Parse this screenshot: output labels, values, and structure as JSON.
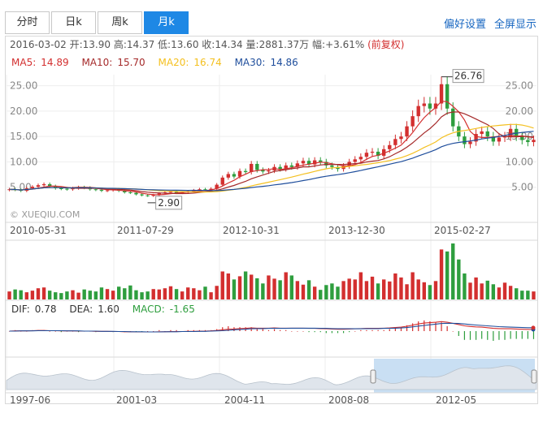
{
  "tabs": [
    {
      "label": "分时",
      "active": false
    },
    {
      "label": "日k",
      "active": false
    },
    {
      "label": "周k",
      "active": false
    },
    {
      "label": "月k",
      "active": true
    }
  ],
  "tools": {
    "prefs": "偏好设置",
    "fullscreen": "全屏显示"
  },
  "info": {
    "date": "2016-03-02",
    "open_label": "开:",
    "open": "13.90",
    "high_label": "高:",
    "high": "14.37",
    "low_label": "低:",
    "low": "13.60",
    "close_label": "收:",
    "close": "14.34",
    "vol_label": "量:",
    "vol": "2881.37万",
    "chg_label": "幅:",
    "chg": "+3.61%",
    "adjust": "(前复权)"
  },
  "ma": [
    {
      "label": "MA5:",
      "value": "14.89",
      "color": "#d32f2f"
    },
    {
      "label": "MA10:",
      "value": "15.70",
      "color": "#a52a2a"
    },
    {
      "label": "MA20:",
      "value": "16.74",
      "color": "#f4c020"
    },
    {
      "label": "MA30:",
      "value": "14.86",
      "color": "#1f4e9c"
    }
  ],
  "macd": [
    {
      "label": "DIF:",
      "value": "0.78",
      "color": "#333333"
    },
    {
      "label": "DEA:",
      "value": "1.60",
      "color": "#333333"
    },
    {
      "label": "MACD:",
      "value": "-1.65",
      "color": "#2e9e3e"
    }
  ],
  "watermark": "© XUEQIU.COM",
  "colors": {
    "up": "#d32f2f",
    "down": "#2e9e3e",
    "ma5": "#d32f2f",
    "ma10": "#a52a2a",
    "ma20": "#f4c020",
    "ma30": "#1f4e9c",
    "navFill": "#dfe5ec",
    "navSel": "#c9dff3"
  },
  "chart_data": {
    "type": "candlestick",
    "y_ticks_left": [
      "25.00",
      "20.00",
      "15.00",
      "10.00",
      "5.00"
    ],
    "y_ticks_right": [
      "25.00",
      "20.00",
      "15.00",
      "10.00",
      "5.00"
    ],
    "ylim": [
      0,
      27.5
    ],
    "x_ticks": [
      "2010-05-31",
      "2011-07-29",
      "2012-10-31",
      "2013-12-30",
      "2015-02-27"
    ],
    "annotations": [
      {
        "label": "26.76",
        "value": 26.76
      },
      {
        "label": "2.90",
        "value": 2.9
      }
    ],
    "close": [
      4.6,
      4.5,
      4.3,
      4.8,
      5.1,
      5.4,
      5.6,
      5.2,
      4.8,
      4.7,
      4.6,
      4.8,
      5.0,
      4.9,
      4.6,
      4.5,
      4.3,
      4.4,
      4.6,
      4.3,
      4.0,
      3.9,
      3.6,
      3.4,
      3.3,
      3.5,
      3.8,
      4.0,
      4.1,
      3.9,
      4.0,
      4.2,
      4.4,
      4.6,
      4.5,
      4.7,
      5.5,
      6.9,
      7.6,
      7.1,
      8.2,
      8.0,
      9.6,
      8.4,
      8.1,
      8.3,
      9.0,
      8.6,
      9.3,
      9.0,
      9.7,
      10.2,
      9.5,
      10.3,
      10.0,
      9.3,
      9.0,
      8.6,
      9.2,
      10.0,
      10.5,
      11.0,
      11.8,
      12.0,
      11.2,
      12.5,
      13.3,
      14.5,
      15.0,
      17.0,
      19.0,
      21.0,
      21.5,
      20.5,
      21.5,
      25.3,
      20.5,
      17.0,
      15.0,
      13.5,
      14.0,
      15.5,
      16.0,
      15.0,
      14.0,
      14.8,
      15.0,
      16.5,
      15.0,
      14.3,
      13.9,
      14.34
    ],
    "volume": [
      2.0,
      2.5,
      2.3,
      1.8,
      2.2,
      2.8,
      3.0,
      2.2,
      1.8,
      1.6,
      2.0,
      2.3,
      1.7,
      2.5,
      2.2,
      2.0,
      3.0,
      2.6,
      2.2,
      3.2,
      2.8,
      3.5,
      2.3,
      1.8,
      2.0,
      2.6,
      2.5,
      2.8,
      3.3,
      2.6,
      2.0,
      3.0,
      2.8,
      2.3,
      3.2,
      1.8,
      3.4,
      7.0,
      6.5,
      5.0,
      5.8,
      7.0,
      6.2,
      5.3,
      4.0,
      6.0,
      5.2,
      4.8,
      6.8,
      6.0,
      4.6,
      3.7,
      4.8,
      3.2,
      2.4,
      3.6,
      4.0,
      3.2,
      4.6,
      5.2,
      5.0,
      6.8,
      4.6,
      5.7,
      4.0,
      5.0,
      4.5,
      6.5,
      5.5,
      3.8,
      6.8,
      5.0,
      4.3,
      3.6,
      4.6,
      12.5,
      12.0,
      14.0,
      10.0,
      6.5,
      4.2,
      5.5,
      4.0,
      4.7,
      3.8,
      3.0,
      4.2,
      3.4,
      2.8,
      2.2,
      2.2,
      2.0
    ],
    "macd_dif": [
      0.0,
      0.1,
      0.1,
      0.1,
      0.2,
      0.3,
      0.3,
      0.2,
      0.2,
      0.1,
      0.1,
      0.1,
      0.0,
      0.0,
      0.0,
      -0.1,
      -0.1,
      -0.1,
      -0.2,
      -0.2,
      -0.3,
      -0.3,
      -0.4,
      -0.4,
      -0.4,
      -0.4,
      -0.3,
      -0.3,
      -0.2,
      -0.2,
      -0.2,
      -0.1,
      -0.1,
      0.0,
      0.0,
      0.1,
      0.3,
      0.6,
      0.9,
      1.0,
      1.2,
      1.3,
      1.5,
      1.4,
      1.4,
      1.4,
      1.5,
      1.4,
      1.4,
      1.4,
      1.4,
      1.4,
      1.3,
      1.3,
      1.2,
      1.1,
      1.0,
      0.9,
      0.9,
      1.0,
      1.1,
      1.2,
      1.3,
      1.3,
      1.3,
      1.4,
      1.5,
      1.7,
      1.9,
      2.3,
      2.8,
      3.4,
      3.8,
      4.0,
      4.2,
      4.5,
      4.2,
      3.7,
      3.1,
      2.5,
      2.2,
      2.0,
      1.9,
      1.6,
      1.3,
      1.2,
      1.1,
      1.1,
      1.0,
      0.9,
      0.8,
      0.78
    ],
    "macd_dea": [
      0.0,
      0.0,
      0.1,
      0.1,
      0.1,
      0.2,
      0.2,
      0.2,
      0.2,
      0.2,
      0.1,
      0.1,
      0.1,
      0.0,
      0.0,
      0.0,
      -0.1,
      -0.1,
      -0.1,
      -0.2,
      -0.2,
      -0.3,
      -0.3,
      -0.3,
      -0.4,
      -0.4,
      -0.4,
      -0.3,
      -0.3,
      -0.3,
      -0.2,
      -0.2,
      -0.2,
      -0.1,
      -0.1,
      0.0,
      0.1,
      0.2,
      0.4,
      0.6,
      0.8,
      0.9,
      1.1,
      1.2,
      1.2,
      1.3,
      1.3,
      1.3,
      1.3,
      1.4,
      1.4,
      1.4,
      1.4,
      1.4,
      1.3,
      1.3,
      1.2,
      1.1,
      1.1,
      1.1,
      1.1,
      1.1,
      1.2,
      1.2,
      1.2,
      1.3,
      1.3,
      1.4,
      1.5,
      1.7,
      2.0,
      2.4,
      2.7,
      3.0,
      3.3,
      3.6,
      3.7,
      3.7,
      3.6,
      3.4,
      3.1,
      2.9,
      2.7,
      2.5,
      2.3,
      2.1,
      2.0,
      1.9,
      1.8,
      1.7,
      1.6,
      1.6
    ],
    "navigator": {
      "x_ticks": [
        "1997-06",
        "2001-03",
        "2004-11",
        "2008-08",
        "2012-05"
      ]
    }
  }
}
